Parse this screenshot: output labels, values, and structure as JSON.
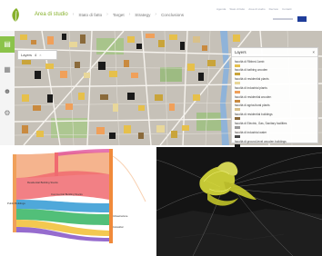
{
  "nav": {
    "items": [
      {
        "label": "Area di studio",
        "active": true
      },
      {
        "label": "Stato di fatto",
        "active": false
      },
      {
        "label": "Target",
        "active": false
      },
      {
        "label": "Strategy",
        "active": false
      },
      {
        "label": "Conclusions",
        "active": false
      }
    ]
  },
  "top_links": [
    "Agenda",
    "Stato di fatto",
    "Area di studio",
    "Decreto",
    "Contatti"
  ],
  "sidebar": [
    {
      "icon": "layers-icon",
      "active": true
    },
    {
      "icon": "building-icon",
      "active": false
    },
    {
      "icon": "people-icon",
      "active": false
    },
    {
      "icon": "gear-icon",
      "active": false
    }
  ],
  "layers_chip": {
    "label": "Layers",
    "count": "4"
  },
  "legend": {
    "title": "Layers",
    "items": [
      {
        "label": "facoltà di Ribbed Jamb",
        "color": "#e6c04b"
      },
      {
        "label": "facoltà di bathing wooden",
        "color": "#c9a43a"
      },
      {
        "label": "facoltà di residential plants",
        "color": "#e8d79a"
      },
      {
        "label": "facoltà di industrial plants",
        "color": "#f0a05a"
      },
      {
        "label": "facoltà di residential wooden",
        "color": "#c98a3f"
      },
      {
        "label": "facoltà di agricultural plants",
        "color": "#d8c08a"
      },
      {
        "label": "facoltà di residential buildings",
        "color": "#8a6a3b"
      },
      {
        "label": "facoltà di Electric, Gas, Sanitary facilities",
        "color": "#9a9a9a"
      },
      {
        "label": "facoltà di industrial water",
        "color": "#4a4a4a"
      },
      {
        "label": "facoltà di ground-level wooden buildings",
        "color": "#1a1a1a"
      },
      {
        "label": "facoltà di Industrial, waste, materials, rubbish and stone",
        "color": "#cfcfcf"
      }
    ]
  },
  "sankey": {
    "labels": [
      "Residential Building Stocks",
      "Commercial Building Stocks",
      "Public Buildings",
      "Infrastructure",
      "Industrial"
    ],
    "colors": [
      "#f3a77a",
      "#f06a70",
      "#3c9ed6",
      "#3fb86a",
      "#f2c23e",
      "#8b5cc9",
      "#e0529c"
    ]
  },
  "colors": {
    "accent": "#8bc34a",
    "nav_active": "#86b02a",
    "map_base": "#c7c2ba",
    "water": "#8fb3d9",
    "view3d_bg": "#141414",
    "yellow_flow": "#e5e83b"
  }
}
